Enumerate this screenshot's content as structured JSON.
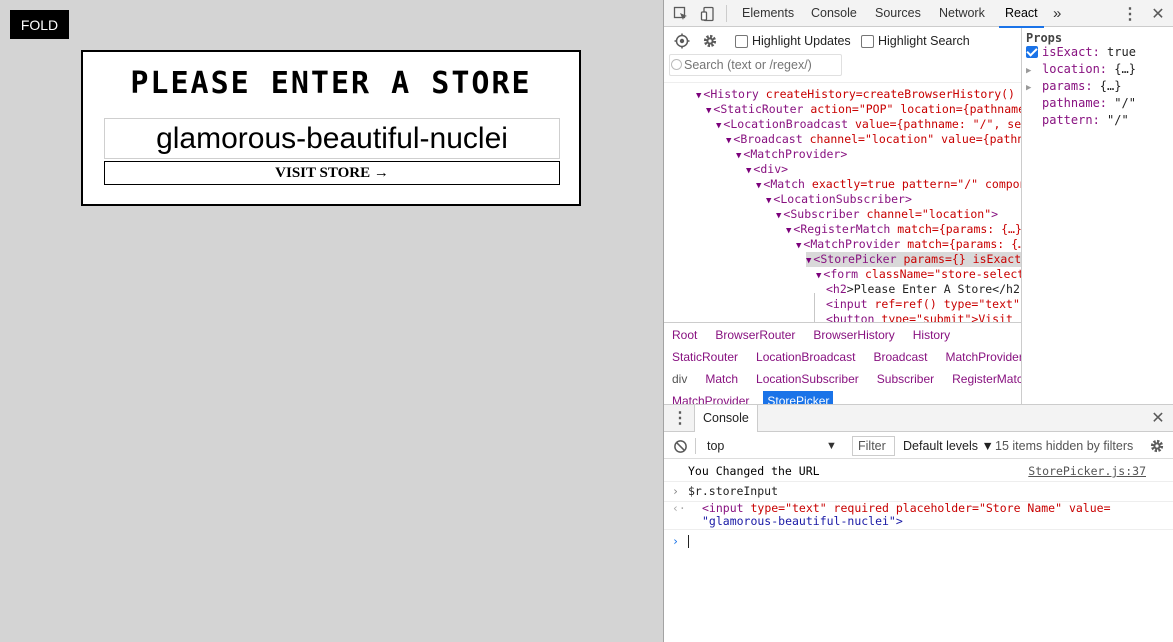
{
  "page": {
    "fold_label": "FOLD",
    "store": {
      "title": "Please Enter A Store",
      "input_value": "glamorous-beautiful-nuclei",
      "input_placeholder": "Store Name",
      "visit_label": "VISIT STORE →"
    }
  },
  "devtools": {
    "tabs": [
      "Elements",
      "Console",
      "Sources",
      "Network",
      "React"
    ],
    "more_tabs": "»",
    "react": {
      "highlight_updates": "Highlight Updates",
      "highlight_search": "Highlight Search",
      "search_placeholder": "Search (text or /regex/)",
      "tree": [
        {
          "indent": 4,
          "tag": "History",
          "attrs": " createHistory=createBrowserHistory() hi"
        },
        {
          "indent": 5,
          "tag": "StaticRouter",
          "attrs": " action=\"POP\" location={pathname:"
        },
        {
          "indent": 6,
          "tag": "LocationBroadcast",
          "attrs": " value={pathname: \"/\", sea"
        },
        {
          "indent": 7,
          "tag": "Broadcast",
          "attrs": " channel=\"location\" value={pathna"
        },
        {
          "indent": 8,
          "tag": "MatchProvider",
          "attrs": ""
        },
        {
          "indent": 9,
          "tag": "div",
          "attrs": ""
        },
        {
          "indent": 10,
          "tag": "Match",
          "attrs": " exactly=true pattern=\"/\" compone"
        },
        {
          "indent": 11,
          "tag": "LocationSubscriber",
          "attrs": ""
        },
        {
          "indent": 12,
          "tag": "Subscriber",
          "attrs": " channel=\"location\""
        },
        {
          "indent": 13,
          "tag": "RegisterMatch",
          "attrs": " match={params: {…},"
        },
        {
          "indent": 14,
          "tag": "MatchProvider",
          "attrs": " match={params: {…"
        },
        {
          "indent": 15,
          "tag": "StorePicker",
          "attrs": " params={} isExact="
        },
        {
          "indent": 16,
          "tag": "form",
          "attrs": " className=\"store-selecto"
        },
        {
          "indent": 17,
          "tag": "h2",
          "attrs": "",
          "text": "Please Enter A Store</h2"
        },
        {
          "indent": 17,
          "tag": "input",
          "attrs": " ref=ref() type=\"text\""
        },
        {
          "indent": 17,
          "tag": "button",
          "attrs": " type=\"submit\">Visit"
        }
      ],
      "breadcrumbs": [
        [
          "Root",
          "BrowserRouter",
          "BrowserHistory",
          "History"
        ],
        [
          "StaticRouter",
          "LocationBroadcast",
          "Broadcast",
          "MatchProvider"
        ],
        [
          "div",
          "Match",
          "LocationSubscriber",
          "Subscriber",
          "RegisterMatch"
        ],
        [
          "MatchProvider",
          "StorePicker"
        ]
      ],
      "props": {
        "title": "Props",
        "items": [
          {
            "key": "isExact",
            "value": "true",
            "kind": "checkbox"
          },
          {
            "key": "location",
            "value": "{…}",
            "kind": "expand"
          },
          {
            "key": "params",
            "value": "{…}",
            "kind": "expand"
          },
          {
            "key": "pathname",
            "value": "\"/\"",
            "kind": "plain"
          },
          {
            "key": "pattern",
            "value": "\"/\"",
            "kind": "plain"
          }
        ]
      }
    },
    "console": {
      "tab_label": "Console",
      "context": "top",
      "filter_placeholder": "Filter",
      "levels": "Default levels ▼",
      "hidden": "15 items hidden by filters",
      "log_text": "You Changed the URL",
      "log_source": "StorePicker.js:37",
      "input_cmd": "$r.storeInput",
      "result_tag_open": "<input",
      "result_attrs": " type=\"text\" required placeholder=\"Store Name\" value=",
      "result_value": "\"glamorous-beautiful-nuclei\">"
    }
  }
}
